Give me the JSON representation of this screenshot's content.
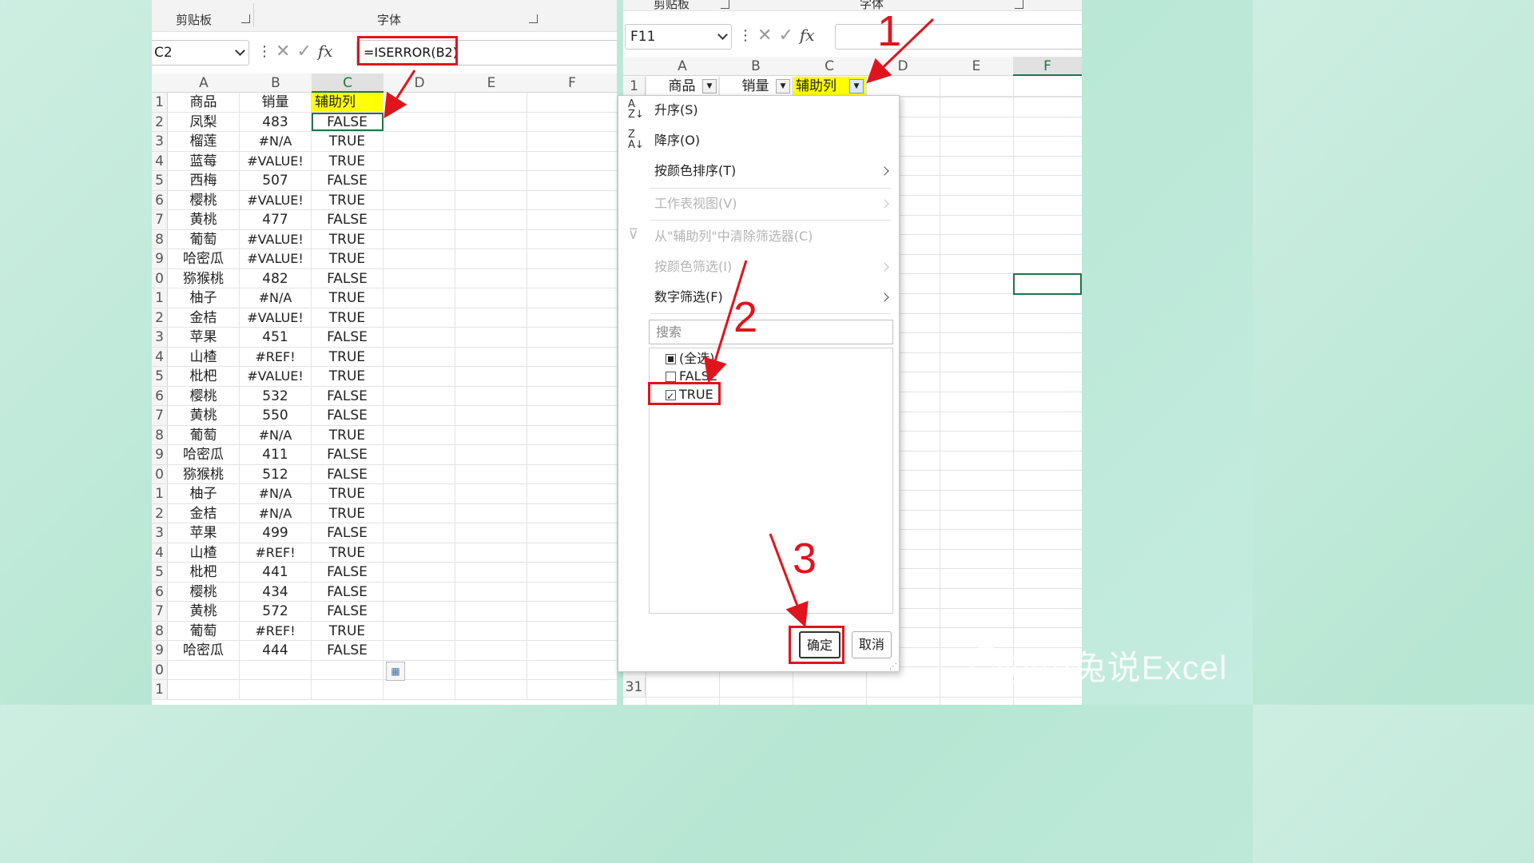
{
  "left": {
    "ribbon": {
      "clipboard": "剪贴板",
      "font": "字体"
    },
    "name_box": "C2",
    "formula": "=ISERROR(B2)",
    "columns": [
      "A",
      "B",
      "C",
      "D",
      "E",
      "F"
    ],
    "rows": [
      {
        "n": "1",
        "a": "商品",
        "b": "销量",
        "c": "辅助列"
      },
      {
        "n": "2",
        "a": "凤梨",
        "b": "483",
        "c": "FALSE"
      },
      {
        "n": "3",
        "a": "榴莲",
        "b": "#N/A",
        "c": "TRUE"
      },
      {
        "n": "4",
        "a": "蓝莓",
        "b": "#VALUE!",
        "c": "TRUE"
      },
      {
        "n": "5",
        "a": "西梅",
        "b": "507",
        "c": "FALSE"
      },
      {
        "n": "6",
        "a": "樱桃",
        "b": "#VALUE!",
        "c": "TRUE"
      },
      {
        "n": "7",
        "a": "黄桃",
        "b": "477",
        "c": "FALSE"
      },
      {
        "n": "8",
        "a": "葡萄",
        "b": "#VALUE!",
        "c": "TRUE"
      },
      {
        "n": "9",
        "a": "哈密瓜",
        "b": "#VALUE!",
        "c": "TRUE"
      },
      {
        "n": "0",
        "a": "猕猴桃",
        "b": "482",
        "c": "FALSE"
      },
      {
        "n": "1",
        "a": "柚子",
        "b": "#N/A",
        "c": "TRUE"
      },
      {
        "n": "2",
        "a": "金桔",
        "b": "#VALUE!",
        "c": "TRUE"
      },
      {
        "n": "3",
        "a": "苹果",
        "b": "451",
        "c": "FALSE"
      },
      {
        "n": "4",
        "a": "山楂",
        "b": "#REF!",
        "c": "TRUE"
      },
      {
        "n": "5",
        "a": "枇杷",
        "b": "#VALUE!",
        "c": "TRUE"
      },
      {
        "n": "6",
        "a": "樱桃",
        "b": "532",
        "c": "FALSE"
      },
      {
        "n": "7",
        "a": "黄桃",
        "b": "550",
        "c": "FALSE"
      },
      {
        "n": "8",
        "a": "葡萄",
        "b": "#N/A",
        "c": "TRUE"
      },
      {
        "n": "9",
        "a": "哈密瓜",
        "b": "411",
        "c": "FALSE"
      },
      {
        "n": "0",
        "a": "猕猴桃",
        "b": "512",
        "c": "FALSE"
      },
      {
        "n": "1",
        "a": "柚子",
        "b": "#N/A",
        "c": "TRUE"
      },
      {
        "n": "2",
        "a": "金桔",
        "b": "#N/A",
        "c": "TRUE"
      },
      {
        "n": "3",
        "a": "苹果",
        "b": "499",
        "c": "FALSE"
      },
      {
        "n": "4",
        "a": "山楂",
        "b": "#REF!",
        "c": "TRUE"
      },
      {
        "n": "5",
        "a": "枇杷",
        "b": "441",
        "c": "FALSE"
      },
      {
        "n": "6",
        "a": "樱桃",
        "b": "434",
        "c": "FALSE"
      },
      {
        "n": "7",
        "a": "黄桃",
        "b": "572",
        "c": "FALSE"
      },
      {
        "n": "8",
        "a": "葡萄",
        "b": "#REF!",
        "c": "TRUE"
      },
      {
        "n": "9",
        "a": "哈密瓜",
        "b": "444",
        "c": "FALSE"
      },
      {
        "n": "0",
        "a": "",
        "b": "",
        "c": ""
      },
      {
        "n": "1",
        "a": "",
        "b": "",
        "c": ""
      }
    ]
  },
  "right": {
    "ribbon": {
      "clipboard": "剪贴板",
      "font": "字体"
    },
    "name_box": "F11",
    "columns": [
      "A",
      "B",
      "C",
      "D",
      "E",
      "F"
    ],
    "header_row": {
      "n": "1",
      "a": "商品",
      "b": "销量",
      "c": "辅助列"
    },
    "bottom_row_number": "31",
    "menu": {
      "sort_asc": "升序(S)",
      "sort_desc": "降序(O)",
      "sort_by_color": "按颜色排序(T)",
      "sheet_view": "工作表视图(V)",
      "clear_filter": "从\"辅助列\"中清除筛选器(C)",
      "filter_by_color": "按颜色筛选(I)",
      "number_filter": "数字筛选(F)",
      "search_placeholder": "搜索",
      "items": [
        {
          "label": "(全选)",
          "state": "partial"
        },
        {
          "label": "FALSE",
          "state": "unchecked"
        },
        {
          "label": "TRUE",
          "state": "checked"
        }
      ],
      "ok": "确定",
      "cancel": "取消"
    }
  },
  "annotations": {
    "step1": "1",
    "step2": "2",
    "step3": "3"
  },
  "watermark": "@小兔说Excel",
  "colors": {
    "accent": "#217346",
    "annotation": "#e0141c",
    "highlight": "#ffff00"
  }
}
